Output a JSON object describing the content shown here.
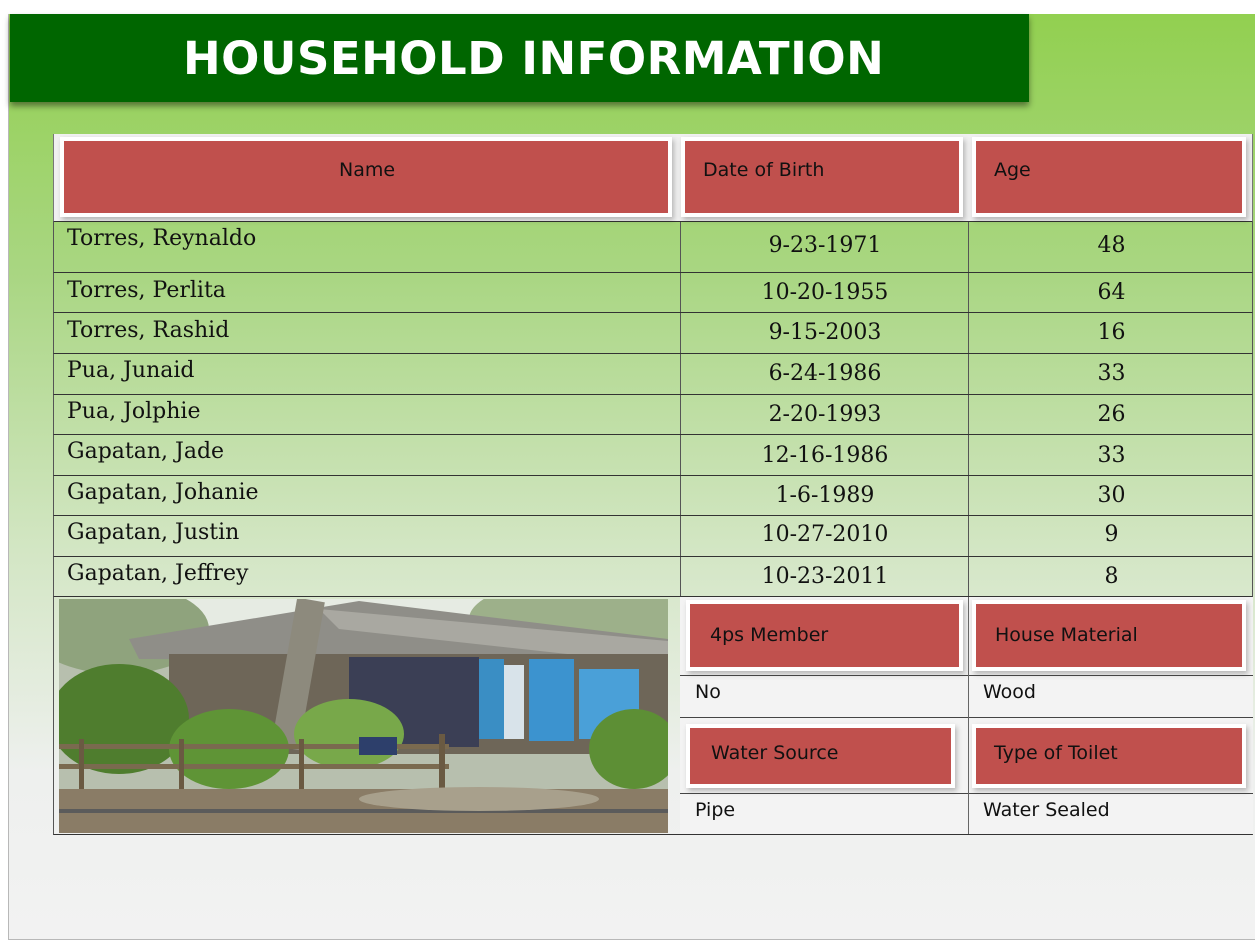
{
  "title": "HOUSEHOLD INFORMATION",
  "table": {
    "headers": {
      "name": "Name",
      "dob": "Date of Birth",
      "age": "Age"
    },
    "rows": [
      {
        "name": "Torres, Reynaldo",
        "dob": "9-23-1971",
        "age": "48"
      },
      {
        "name": "Torres, Perlita",
        "dob": "10-20-1955",
        "age": "64"
      },
      {
        "name": "Torres, Rashid",
        "dob": "9-15-2003",
        "age": "16"
      },
      {
        "name": "Pua, Junaid",
        "dob": "6-24-1986",
        "age": "33"
      },
      {
        "name": "Pua, Jolphie",
        "dob": "2-20-1993",
        "age": "26"
      },
      {
        "name": "Gapatan, Jade",
        "dob": "12-16-1986",
        "age": "33"
      },
      {
        "name": "Gapatan, Johanie",
        "dob": "1-6-1989",
        "age": "30"
      },
      {
        "name": "Gapatan, Justin",
        "dob": "10-27-2010",
        "age": "9"
      },
      {
        "name": "Gapatan, Jeffrey",
        "dob": "10-23-2011",
        "age": "8"
      }
    ]
  },
  "details": {
    "fourps_label": "4ps Member",
    "fourps_value": "No",
    "house_material_label": "House Material",
    "house_material_value": "Wood",
    "water_source_label": "Water Source",
    "water_source_value": "Pipe",
    "toilet_label": "Type of Toilet",
    "toilet_value": "Water Sealed"
  },
  "colors": {
    "title_band": "#006600",
    "header_cell": "#c0504d",
    "background_top": "#92d050",
    "background_bottom": "#f2f2f2"
  }
}
